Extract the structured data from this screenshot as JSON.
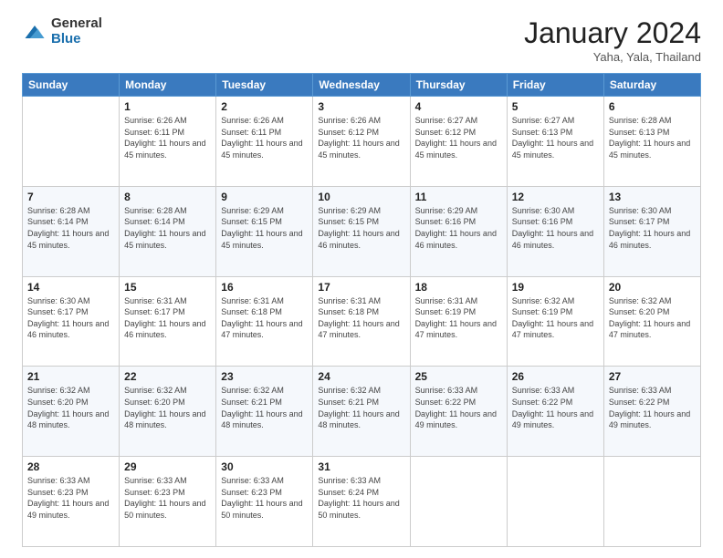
{
  "header": {
    "logo_general": "General",
    "logo_blue": "Blue",
    "title": "January 2024",
    "location": "Yaha, Yala, Thailand"
  },
  "days_of_week": [
    "Sunday",
    "Monday",
    "Tuesday",
    "Wednesday",
    "Thursday",
    "Friday",
    "Saturday"
  ],
  "weeks": [
    [
      {
        "day": "",
        "sunrise": "",
        "sunset": "",
        "daylight": ""
      },
      {
        "day": "1",
        "sunrise": "6:26 AM",
        "sunset": "6:11 PM",
        "daylight": "11 hours and 45 minutes."
      },
      {
        "day": "2",
        "sunrise": "6:26 AM",
        "sunset": "6:11 PM",
        "daylight": "11 hours and 45 minutes."
      },
      {
        "day": "3",
        "sunrise": "6:26 AM",
        "sunset": "6:12 PM",
        "daylight": "11 hours and 45 minutes."
      },
      {
        "day": "4",
        "sunrise": "6:27 AM",
        "sunset": "6:12 PM",
        "daylight": "11 hours and 45 minutes."
      },
      {
        "day": "5",
        "sunrise": "6:27 AM",
        "sunset": "6:13 PM",
        "daylight": "11 hours and 45 minutes."
      },
      {
        "day": "6",
        "sunrise": "6:28 AM",
        "sunset": "6:13 PM",
        "daylight": "11 hours and 45 minutes."
      }
    ],
    [
      {
        "day": "7",
        "sunrise": "6:28 AM",
        "sunset": "6:14 PM",
        "daylight": "11 hours and 45 minutes."
      },
      {
        "day": "8",
        "sunrise": "6:28 AM",
        "sunset": "6:14 PM",
        "daylight": "11 hours and 45 minutes."
      },
      {
        "day": "9",
        "sunrise": "6:29 AM",
        "sunset": "6:15 PM",
        "daylight": "11 hours and 45 minutes."
      },
      {
        "day": "10",
        "sunrise": "6:29 AM",
        "sunset": "6:15 PM",
        "daylight": "11 hours and 46 minutes."
      },
      {
        "day": "11",
        "sunrise": "6:29 AM",
        "sunset": "6:16 PM",
        "daylight": "11 hours and 46 minutes."
      },
      {
        "day": "12",
        "sunrise": "6:30 AM",
        "sunset": "6:16 PM",
        "daylight": "11 hours and 46 minutes."
      },
      {
        "day": "13",
        "sunrise": "6:30 AM",
        "sunset": "6:17 PM",
        "daylight": "11 hours and 46 minutes."
      }
    ],
    [
      {
        "day": "14",
        "sunrise": "6:30 AM",
        "sunset": "6:17 PM",
        "daylight": "11 hours and 46 minutes."
      },
      {
        "day": "15",
        "sunrise": "6:31 AM",
        "sunset": "6:17 PM",
        "daylight": "11 hours and 46 minutes."
      },
      {
        "day": "16",
        "sunrise": "6:31 AM",
        "sunset": "6:18 PM",
        "daylight": "11 hours and 47 minutes."
      },
      {
        "day": "17",
        "sunrise": "6:31 AM",
        "sunset": "6:18 PM",
        "daylight": "11 hours and 47 minutes."
      },
      {
        "day": "18",
        "sunrise": "6:31 AM",
        "sunset": "6:19 PM",
        "daylight": "11 hours and 47 minutes."
      },
      {
        "day": "19",
        "sunrise": "6:32 AM",
        "sunset": "6:19 PM",
        "daylight": "11 hours and 47 minutes."
      },
      {
        "day": "20",
        "sunrise": "6:32 AM",
        "sunset": "6:20 PM",
        "daylight": "11 hours and 47 minutes."
      }
    ],
    [
      {
        "day": "21",
        "sunrise": "6:32 AM",
        "sunset": "6:20 PM",
        "daylight": "11 hours and 48 minutes."
      },
      {
        "day": "22",
        "sunrise": "6:32 AM",
        "sunset": "6:20 PM",
        "daylight": "11 hours and 48 minutes."
      },
      {
        "day": "23",
        "sunrise": "6:32 AM",
        "sunset": "6:21 PM",
        "daylight": "11 hours and 48 minutes."
      },
      {
        "day": "24",
        "sunrise": "6:32 AM",
        "sunset": "6:21 PM",
        "daylight": "11 hours and 48 minutes."
      },
      {
        "day": "25",
        "sunrise": "6:33 AM",
        "sunset": "6:22 PM",
        "daylight": "11 hours and 49 minutes."
      },
      {
        "day": "26",
        "sunrise": "6:33 AM",
        "sunset": "6:22 PM",
        "daylight": "11 hours and 49 minutes."
      },
      {
        "day": "27",
        "sunrise": "6:33 AM",
        "sunset": "6:22 PM",
        "daylight": "11 hours and 49 minutes."
      }
    ],
    [
      {
        "day": "28",
        "sunrise": "6:33 AM",
        "sunset": "6:23 PM",
        "daylight": "11 hours and 49 minutes."
      },
      {
        "day": "29",
        "sunrise": "6:33 AM",
        "sunset": "6:23 PM",
        "daylight": "11 hours and 50 minutes."
      },
      {
        "day": "30",
        "sunrise": "6:33 AM",
        "sunset": "6:23 PM",
        "daylight": "11 hours and 50 minutes."
      },
      {
        "day": "31",
        "sunrise": "6:33 AM",
        "sunset": "6:24 PM",
        "daylight": "11 hours and 50 minutes."
      },
      {
        "day": "",
        "sunrise": "",
        "sunset": "",
        "daylight": ""
      },
      {
        "day": "",
        "sunrise": "",
        "sunset": "",
        "daylight": ""
      },
      {
        "day": "",
        "sunrise": "",
        "sunset": "",
        "daylight": ""
      }
    ]
  ],
  "labels": {
    "sunrise_prefix": "Sunrise: ",
    "sunset_prefix": "Sunset: ",
    "daylight_prefix": "Daylight: "
  }
}
